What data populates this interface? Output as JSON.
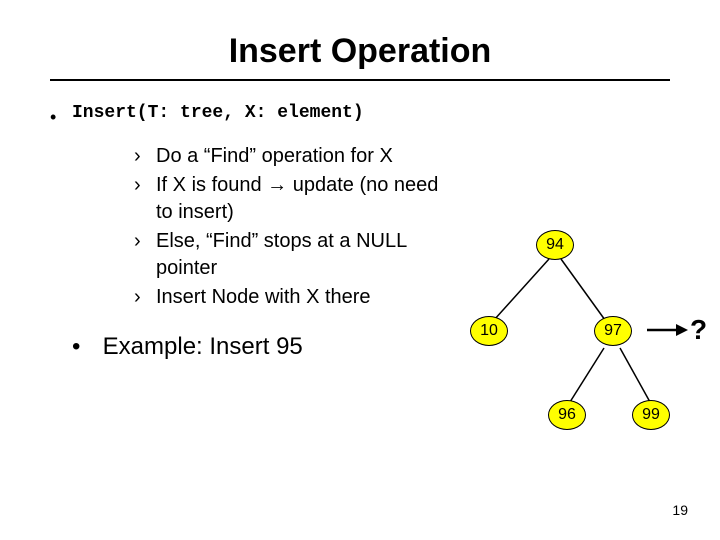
{
  "title": "Insert Operation",
  "signature": "Insert(T: tree, X: element)",
  "bullet_marker": "•",
  "sub_marker": "›",
  "steps": {
    "a": "Do a “Find” operation for X",
    "b": "If X is found → update (no need to insert)",
    "c": "Else, “Find” stops at a NULL pointer",
    "d": "Insert Node with X there"
  },
  "example": "Example: Insert 95",
  "nodes": {
    "root": "94",
    "left": "10",
    "right": "97",
    "rleft": "96",
    "rright": "99"
  },
  "question": "?",
  "page": "19",
  "chart_data": {
    "type": "tree",
    "root": 94,
    "edges": [
      {
        "from": 94,
        "to": 10
      },
      {
        "from": 94,
        "to": 97
      },
      {
        "from": 97,
        "to": 96
      },
      {
        "from": 97,
        "to": 99
      }
    ],
    "insert_value": 95,
    "insert_target_parent": 97,
    "annotation": "?"
  }
}
